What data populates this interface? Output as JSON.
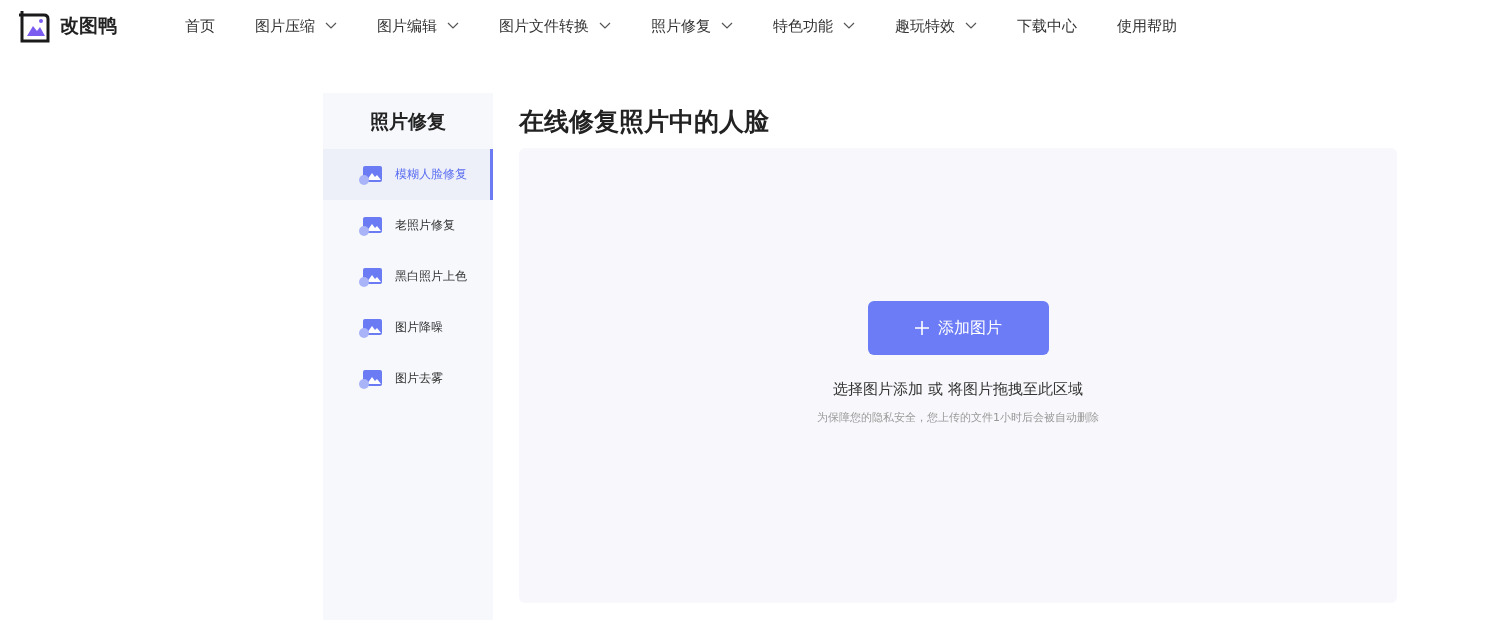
{
  "logo": {
    "text": "改图鸭"
  },
  "nav": [
    {
      "label": "首页",
      "dropdown": false
    },
    {
      "label": "图片压缩",
      "dropdown": true
    },
    {
      "label": "图片编辑",
      "dropdown": true
    },
    {
      "label": "图片文件转换",
      "dropdown": true
    },
    {
      "label": "照片修复",
      "dropdown": true
    },
    {
      "label": "特色功能",
      "dropdown": true
    },
    {
      "label": "趣玩特效",
      "dropdown": true
    },
    {
      "label": "下载中心",
      "dropdown": false
    },
    {
      "label": "使用帮助",
      "dropdown": false
    }
  ],
  "sidebar": {
    "title": "照片修复",
    "items": [
      {
        "label": "模糊人脸修复",
        "selected": true
      },
      {
        "label": "老照片修复",
        "selected": false
      },
      {
        "label": "黑白照片上色",
        "selected": false
      },
      {
        "label": "图片降噪",
        "selected": false
      },
      {
        "label": "图片去雾",
        "selected": false
      }
    ]
  },
  "main": {
    "title": "在线修复照片中的人脸",
    "upload": {
      "button": "添加图片",
      "hint": "选择图片添加 或 将图片拖拽至此区域",
      "note": "为保障您的隐私安全，您上传的文件1小时后会被自动删除"
    }
  }
}
